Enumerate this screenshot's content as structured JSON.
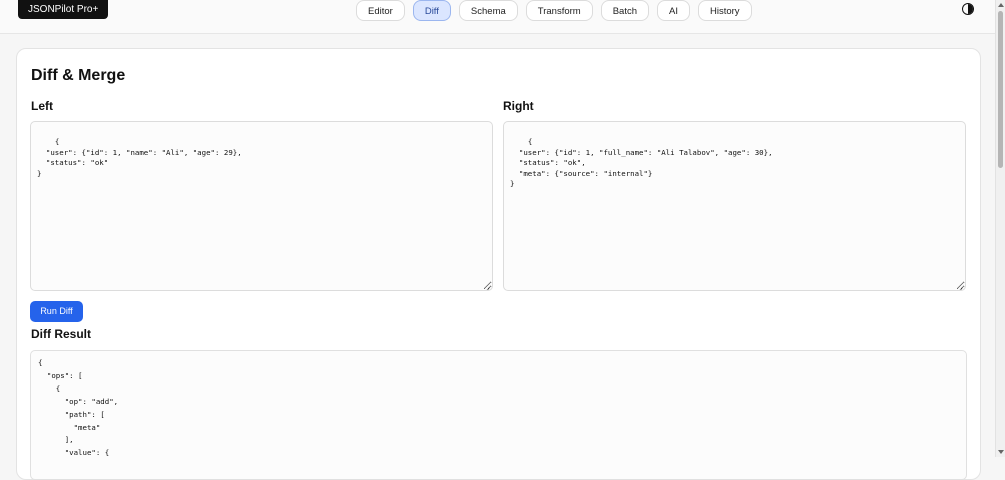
{
  "header": {
    "brand": "JSONPilot Pro+",
    "tabs": [
      "Editor",
      "Diff",
      "Schema",
      "Transform",
      "Batch",
      "AI",
      "History"
    ],
    "active_tab": "Diff",
    "theme_icon": "contrast-icon"
  },
  "main": {
    "title": "Diff & Merge",
    "left_label": "Left",
    "right_label": "Right",
    "left_value": "{\n  \"user\": {\"id\": 1, \"name\": \"Ali\", \"age\": 29},\n  \"status\": \"ok\"\n}",
    "right_value": "{\n  \"user\": {\"id\": 1, \"full_name\": \"Ali Talabov\", \"age\": 30},\n  \"status\": \"ok\",\n  \"meta\": {\"source\": \"internal\"}\n}",
    "run_button": "Run Diff",
    "result_label": "Diff Result",
    "result_value": "{\n  \"ops\": [\n    {\n      \"op\": \"add\",\n      \"path\": [\n        \"meta\"\n      ],\n      \"value\": {"
  },
  "colors": {
    "accent": "#2563eb",
    "active_tab_bg": "#dbe6ff"
  }
}
